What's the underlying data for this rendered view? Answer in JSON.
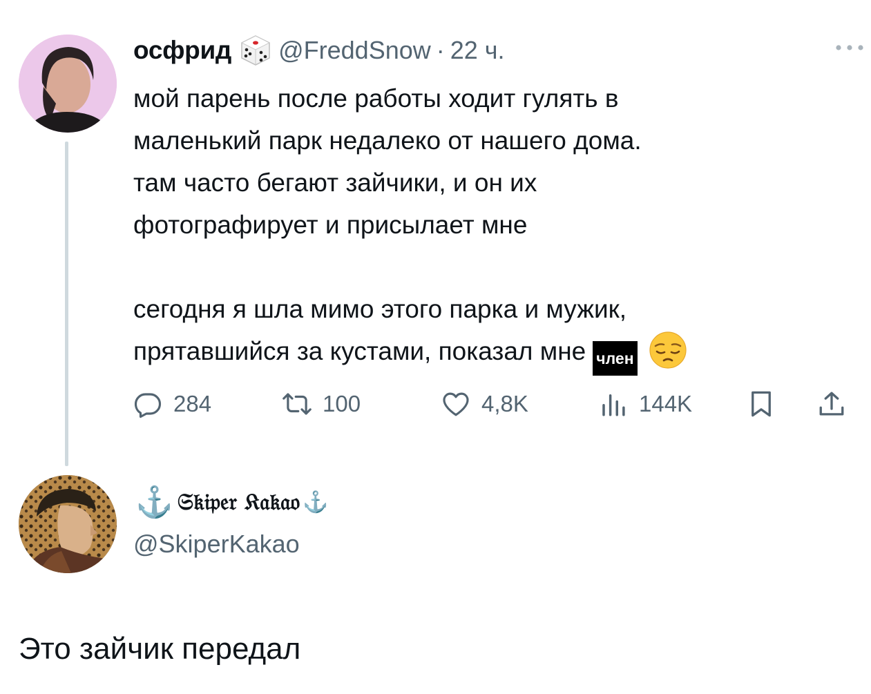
{
  "tweet": {
    "author_name": "осфрид",
    "author_emoji_icon": "game-die-icon",
    "handle": "@FreddSnow",
    "separator": "·",
    "time": "22 ч.",
    "more_icon": "ellipsis-icon",
    "lines": [
      "мой парень после работы ходит гулять в",
      "маленький парк недалеко от нашего дома.",
      "там часто бегают зайчики, и он их",
      "фотографирует и присылает мне"
    ],
    "line2a": "сегодня я шла мимо этого парка и мужик,",
    "line2b": "прятавшийся за кустами, показал мне",
    "censored_word": "член",
    "end_emoji_icon": "pensive-face-icon",
    "actions": {
      "replies": "284",
      "retweets": "100",
      "likes": "4,8K",
      "views": "144K"
    }
  },
  "reply": {
    "author_name": "𝔖𝔨𝔦𝔭𝔢𝔯 𝔎𝔞𝔨𝔞𝔬",
    "anchor_left": "⚓",
    "anchor_right": "⚓",
    "handle": "@SkiperKakao",
    "text": "Это зайчик передал"
  },
  "colors": {
    "text": "#0f1419",
    "secondary": "#536471",
    "thread_line": "#cfd9de"
  }
}
